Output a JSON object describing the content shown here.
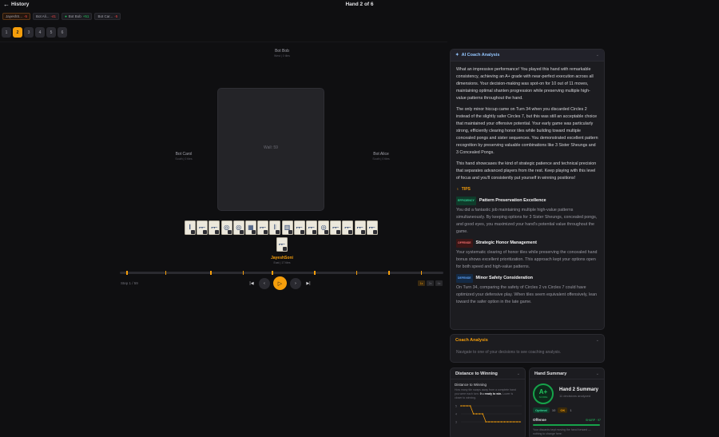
{
  "header": {
    "back_label": "History",
    "title": "Hand 2 of 6"
  },
  "players": [
    {
      "name": "JayeshS...",
      "delta": "-5",
      "sign": "neg",
      "dot": false,
      "active": true
    },
    {
      "name": "Bot Ali...",
      "delta": "-41",
      "sign": "neg",
      "dot": false,
      "active": false
    },
    {
      "name": "Bot Bob",
      "delta": "+51",
      "sign": "pos",
      "dot": true,
      "active": false
    },
    {
      "name": "Bot Car...",
      "delta": "-5",
      "sign": "neg",
      "dot": false,
      "active": false
    }
  ],
  "hands": [
    "1",
    "2",
    "3",
    "4",
    "5",
    "6"
  ],
  "active_hand": "2",
  "seats": {
    "north": {
      "name": "Bot Bob",
      "sub": "West | 0 tiles"
    },
    "west": {
      "name": "Bot Carol",
      "sub": "South | 0 tiles"
    },
    "east": {
      "name": "Bot Alice",
      "sub": "South | 0 tiles"
    },
    "south": {
      "name": "JayeshSoni",
      "sub": "East | 17 tiles"
    }
  },
  "wall_label": "Wall: 59",
  "tiles": [
    "𝄃",
    "𐎀",
    "𐎀",
    "◎",
    "◎",
    "▦",
    "𐎀",
    "𝄃",
    "▥",
    "𐎀",
    "𐎀",
    "◎",
    "𐎀",
    "𐎀",
    "𐎀",
    "𐎀"
  ],
  "drawn_tile": "𐎀",
  "replay": {
    "step": "Step 1 / 59",
    "progress": 0.02,
    "speeds": [
      "1x",
      "2x",
      "4x"
    ],
    "active_speed": "1x",
    "controls": {
      "first": "|◀",
      "prev": "‹",
      "play": "▷",
      "next": "›",
      "last": "▶|"
    }
  },
  "coach": {
    "title": "AI Coach Analysis",
    "paragraphs": [
      "What an impressive performance! You played this hand with remarkable consistency, achieving an A+ grade with near-perfect execution across all dimensions. Your decision-making was spot-on for 10 out of 11 moves, maintaining optimal shanten progression while preserving multiple high-value patterns throughout the hand.",
      "The only minor hiccup came on Turn 34 when you discarded Circles 2 instead of the slightly safer Circles 7, but this was still an acceptable choice that maintained your offensive potential. Your early game was particularly strong, efficiently clearing honor tiles while building toward multiple concealed pongs and sister sequences. You demonstrated excellent pattern recognition by preserving valuable combinations like 3 Sister Sheungs and 3 Concealed Pongs.",
      "This hand showcases the kind of strategic patience and technical precision that separates advanced players from the rest. Keep playing with this level of focus and you'll consistently put yourself in winning positions!"
    ],
    "tips_label": "TIPS",
    "tips": [
      {
        "badge": "EFFICIENCY",
        "kind": "b-eff",
        "title": "Pattern Preservation Excellence",
        "body": "You did a fantastic job maintaining multiple high-value patterns simultaneously. By keeping options for 3 Sister Sheungs, concealed pongs, and good eyes, you maximized your hand's potential value throughout the game."
      },
      {
        "badge": "OFFENSE",
        "kind": "b-off",
        "title": "Strategic Honor Management",
        "body": "Your systematic clearing of honor tiles while preserving the concealed hand bonus shows excellent prioritization. This approach kept your options open for both speed and high-value patterns."
      },
      {
        "badge": "DEFENSE",
        "kind": "b-def",
        "title": "Minor Safety Consideration",
        "body": "On Turn 34, comparing the safety of Circles 2 vs Circles 7 could have optimized your defensive play. When tiles seem equivalent offensively, lean toward the safer option in the late game."
      }
    ]
  },
  "coach_analysis": {
    "title": "Coach Analysis",
    "text": "Navigate to one of your decisions to see coaching analysis."
  },
  "distance": {
    "title": "Distance to Winning",
    "sub_title": "Distance to Winning",
    "desc_a": "How many tile swaps away from a complete hand you were each turn.",
    "desc_b": "0 = ready to win.",
    "desc_c": "Lower is closer to winning.",
    "y_labels": [
      "5",
      "4",
      "3"
    ]
  },
  "chart_data": {
    "type": "line",
    "title": "Distance to Winning",
    "y": [
      5,
      5,
      5,
      5,
      4,
      4,
      4,
      4,
      3,
      3,
      3,
      3,
      3,
      3,
      3,
      3,
      3,
      3,
      3,
      3
    ]
  },
  "summary": {
    "title": "Hand Summary",
    "grade": "A+",
    "score": "SCORE",
    "heading": "Hand 2 Summary",
    "decisions": "11 decisions analyzed",
    "optimal_label": "Optimal",
    "optimal_count": "10",
    "ok_label": "OK",
    "ok_count": "1",
    "offense_label": "Offense",
    "offense_value": "SHARP · 97",
    "offense_text": "Your discards kept moving the hand forward — nothing to change here."
  },
  "colors": {
    "accent": "#f59e0b",
    "bg": "#0f0f11",
    "panel": "#1c1c20",
    "good": "#22c55e",
    "bad": "#ef4444"
  }
}
